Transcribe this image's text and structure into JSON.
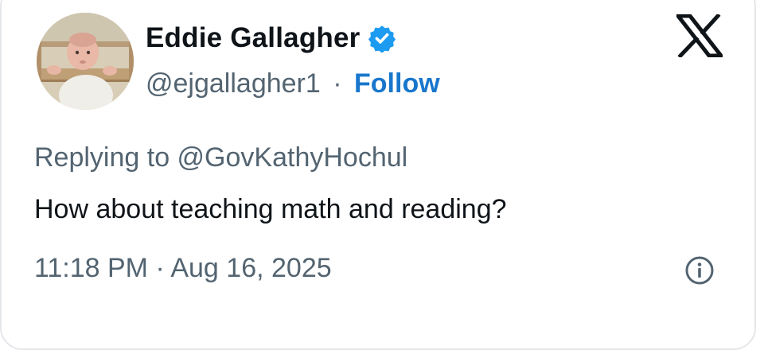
{
  "author": {
    "display_name": "Eddie Gallagher",
    "handle": "@ejgallagher1",
    "verified": true,
    "verified_badge_color": "#1d9bf0",
    "avatar": "baby-in-crib-photo"
  },
  "separator": "·",
  "follow_label": "Follow",
  "follow_color": "#1877cc",
  "reply_context": "Replying to @GovKathyHochul",
  "text": "How about teaching math and reading?",
  "timestamp": "11:18 PM · Aug 16, 2025",
  "icons": {
    "brand": "x-logo-icon",
    "info": "info-icon",
    "verified": "verified-badge-icon"
  },
  "colors": {
    "primary_text": "#0f1419",
    "secondary_text": "#536471",
    "border": "#e4e7ea"
  }
}
